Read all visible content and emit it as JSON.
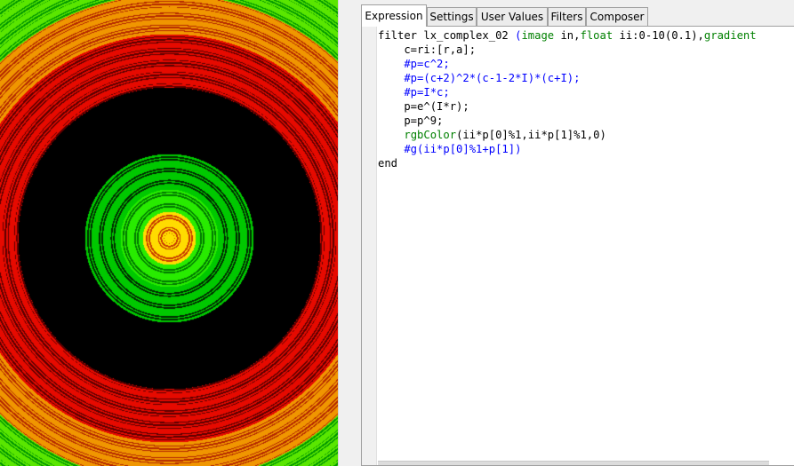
{
  "tabs": [
    {
      "label": "Expression",
      "active": true
    },
    {
      "label": "Settings",
      "active": false
    },
    {
      "label": "User Values",
      "active": false
    },
    {
      "label": "Filters",
      "active": false
    },
    {
      "label": "Composer",
      "active": false
    }
  ],
  "code": {
    "lines": [
      [
        {
          "t": "filter lx_complex_02 ",
          "c": "kw"
        },
        {
          "t": "(",
          "c": "cm"
        },
        {
          "t": "image",
          "c": "type"
        },
        {
          "t": " in,",
          "c": "kw"
        },
        {
          "t": "float",
          "c": "type"
        },
        {
          "t": " ii:0-10(0.1),",
          "c": "kw"
        },
        {
          "t": "gradient",
          "c": "type"
        }
      ],
      [
        {
          "t": "    c=ri:[r,a];",
          "c": "kw"
        }
      ],
      [
        {
          "t": "    #p=c^2;",
          "c": "cm"
        }
      ],
      [
        {
          "t": "    #p=(c+2)^2*(c-1-2*I)*(c+I);",
          "c": "cm"
        }
      ],
      [
        {
          "t": "    #p=I*c;",
          "c": "cm"
        }
      ],
      [
        {
          "t": "    p=e^(I*r);",
          "c": "kw"
        }
      ],
      [
        {
          "t": "    p=p^9;",
          "c": "kw"
        }
      ],
      [
        {
          "t": "    ",
          "c": "kw"
        },
        {
          "t": "rgbColor",
          "c": "fn"
        },
        {
          "t": "(ii*p[0]%1,ii*p[1]%1,0)",
          "c": "kw"
        }
      ],
      [
        {
          "t": "    #g(ii*p[0]%1+p[1])",
          "c": "cm"
        }
      ],
      [
        {
          "t": "end",
          "c": "kw"
        }
      ]
    ]
  },
  "colors": {
    "comment": "#0000ff",
    "type": "#008000",
    "text": "#000000"
  },
  "preview": {
    "render": "concentric-rings",
    "palette": [
      "#000000",
      "#ff0000",
      "#00ff00",
      "#ffff00"
    ]
  }
}
